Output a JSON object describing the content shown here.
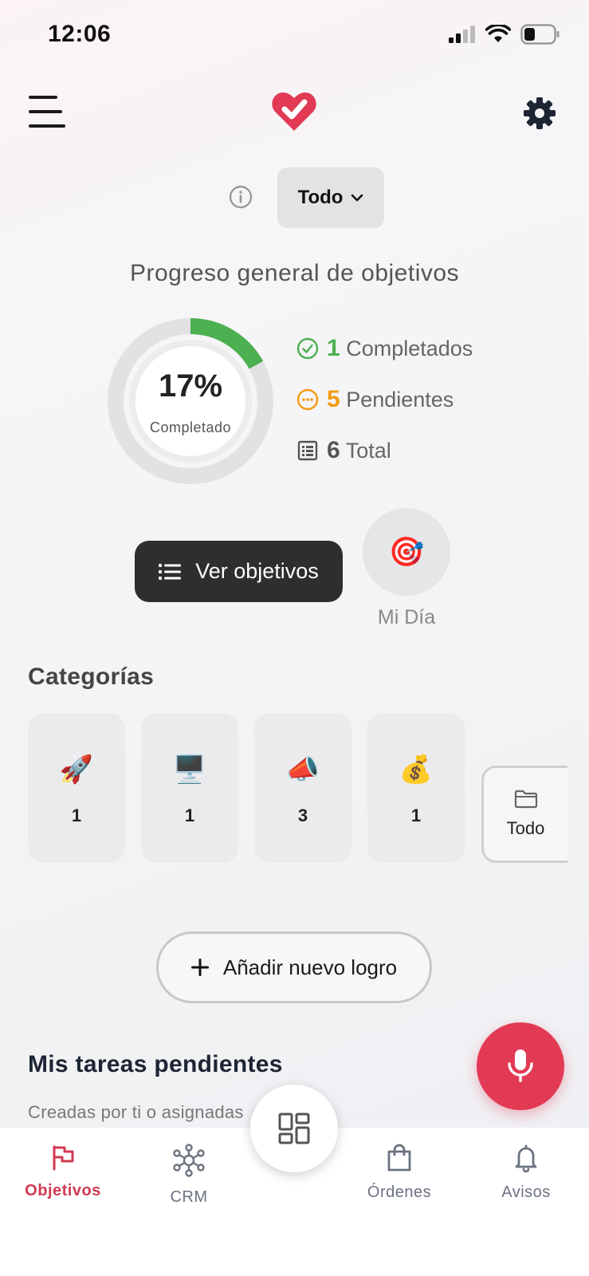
{
  "status_bar": {
    "time": "12:06"
  },
  "header": {
    "filter_label": "Todo"
  },
  "progress": {
    "title": "Progreso general de objetivos",
    "percent_label": "17%",
    "percent_value": 17,
    "sub_label": "Completado",
    "completed_count": "1",
    "completed_label": "Completados",
    "pending_count": "5",
    "pending_label": "Pendientes",
    "total_count": "6",
    "total_label": "Total"
  },
  "actions": {
    "view_goals_label": "Ver objetivos",
    "my_day_emoji": "🎯",
    "my_day_label": "Mi Día"
  },
  "categories": {
    "title": "Categorías",
    "items": [
      {
        "emoji": "🚀",
        "count": "1"
      },
      {
        "emoji": "🖥️",
        "count": "1"
      },
      {
        "emoji": "📣",
        "count": "3"
      },
      {
        "emoji": "💰",
        "count": "1"
      }
    ],
    "all_label": "Todo"
  },
  "add_button_label": "Añadir nuevo logro",
  "tasks": {
    "title": "Mis tareas pendientes",
    "subtitle": "Creadas por ti o asignadas"
  },
  "bottom_nav": {
    "items": [
      {
        "label": "Objetivos",
        "icon": "flag-icon",
        "active": true
      },
      {
        "label": "CRM",
        "icon": "network-icon",
        "active": false
      },
      {
        "label": "Órdenes",
        "icon": "shopping-bag-icon",
        "active": false
      },
      {
        "label": "Avisos",
        "icon": "bell-icon",
        "active": false
      }
    ],
    "center_icon": "dashboard-icon"
  },
  "colors": {
    "brand": "#e23a55",
    "success": "#4caf50",
    "warning": "#f39c12",
    "dark_button": "#2e2e2e"
  }
}
